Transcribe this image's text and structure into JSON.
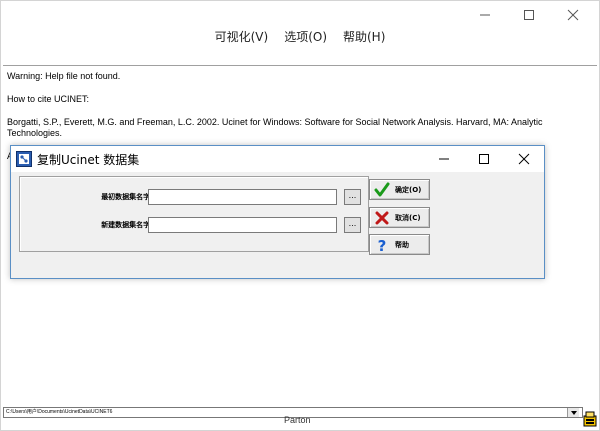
{
  "window": {
    "menu": [
      "可视化(V)",
      "选项(O)",
      "帮助(H)"
    ]
  },
  "content": {
    "lines": [
      "Warning: Help file not found.",
      "How to cite UCINET:",
      "Borgatti, S.P., Everett, M.G. and Freeman, L.C. 2002. Ucinet for Windows: Software for Social Network Analysis. Harvard, MA: Analytic",
      "Technologies.",
      "A"
    ]
  },
  "status": {
    "path": "C:\\Users\\用户\\Documents\\UcinetData\\UCINET6",
    "bottom_text": "Parton"
  },
  "dialog": {
    "title": "复制Ucinet 数据集",
    "fields": [
      {
        "label": "最初数据集名字:",
        "value": "",
        "browse": "..."
      },
      {
        "label": "新建数据集名字:",
        "value": "",
        "browse": "..."
      }
    ],
    "buttons": {
      "ok": "确定(O)",
      "cancel": "取消(C)",
      "help": "帮助"
    }
  },
  "colors": {
    "dialog_border": "#5a8fc5",
    "ok_icon": "#1a9a1a",
    "cancel_icon": "#c01818",
    "help_icon": "#1a5fd0"
  }
}
